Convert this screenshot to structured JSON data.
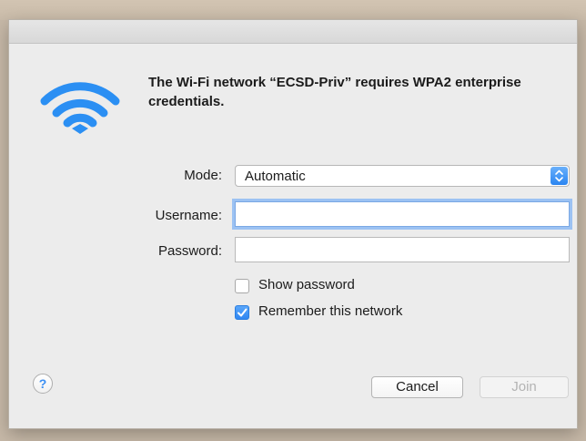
{
  "dialog": {
    "message": "The Wi-Fi network “ECSD-Priv” requires WPA2 enterprise credentials."
  },
  "icons": {
    "wifi": "wifi-icon",
    "help": "help-icon",
    "stepper": "chevron-updown-icon",
    "checkmark": "checkmark-icon"
  },
  "form": {
    "mode_label": "Mode:",
    "mode_value": "Automatic",
    "username_label": "Username:",
    "username_value": "",
    "password_label": "Password:",
    "password_value": "",
    "show_password_label": "Show password",
    "show_password_checked": false,
    "remember_label": "Remember this network",
    "remember_checked": true
  },
  "buttons": {
    "help": "?",
    "cancel": "Cancel",
    "join": "Join",
    "join_enabled": false
  },
  "colors": {
    "accent": "#2f87f2",
    "wifi_icon": "#2b8ff3",
    "dialog_bg": "#ececec",
    "disabled_text": "#b3b3b3"
  }
}
